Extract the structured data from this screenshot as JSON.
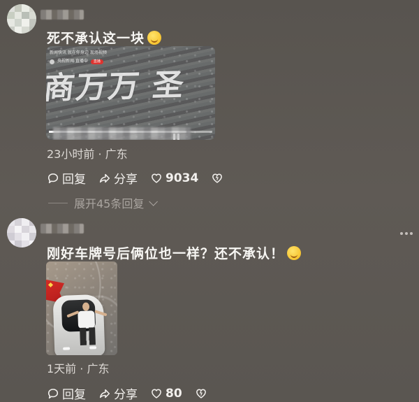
{
  "comments": [
    {
      "text": "死不承认这一块",
      "emoji": "smiling-face",
      "media": {
        "type": "video",
        "header_line": "新闻快讯 就在你身边 现场视频",
        "channel_label": "央视新闻 直播中",
        "badge": "直播",
        "road_text": "商万万 圣",
        "progress": 0.84
      },
      "meta": "23小时前 · 广东",
      "reply_label": "回复",
      "share_label": "分享",
      "like_count": "9034",
      "expand_replies": "展开45条回复"
    },
    {
      "text": "刚好车牌号后俩位也一样？还不承认！",
      "emoji": "laughing-tears",
      "media": {
        "type": "photo",
        "subject": "person-on-car-roof"
      },
      "meta": "1天前 · 广东",
      "reply_label": "回复",
      "share_label": "分享",
      "like_count": "80"
    }
  ],
  "colors": {
    "background": "#5b5752",
    "text_primary": "#f7f6f3",
    "text_secondary": "#ddd9d5",
    "muted": "#aaa5a0",
    "accent_red": "#e4312d"
  },
  "icons": {
    "reply": "comment-bubble-icon",
    "share": "share-arrow-icon",
    "like": "heart-icon",
    "dislike": "broken-heart-icon",
    "more": "more-options-icon",
    "expand": "chevron-down-icon"
  }
}
